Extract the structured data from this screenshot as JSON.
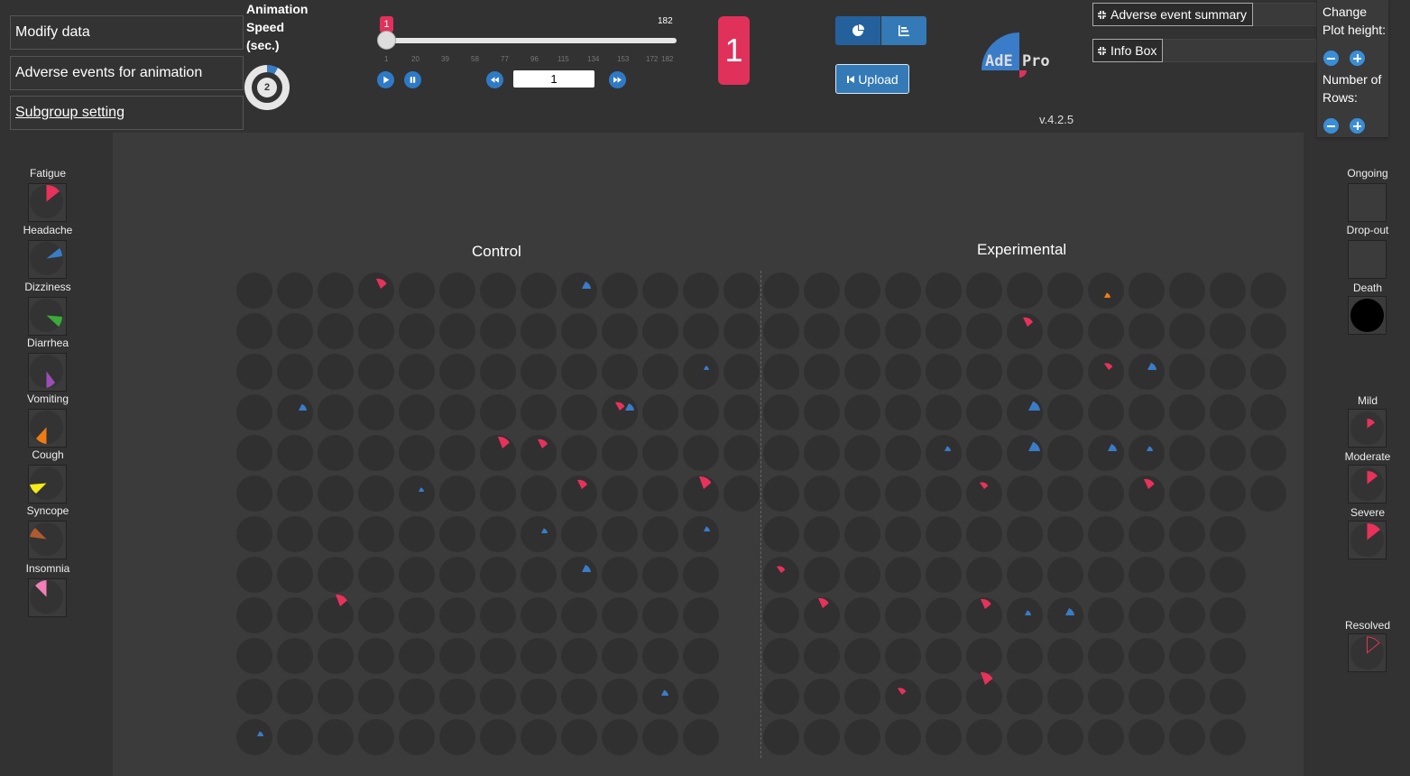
{
  "menu": {
    "modify_data": "Modify data",
    "adverse_events_animation": "Adverse events for animation",
    "subgroup_setting": "Subgroup setting"
  },
  "speed": {
    "label_line1": "Animation",
    "label_line2": "Speed",
    "label_line3": "(sec.)",
    "value": "2"
  },
  "slider": {
    "current": "1",
    "max": "182",
    "ticks": [
      "1",
      "20",
      "39",
      "58",
      "77",
      "96",
      "115",
      "134",
      "153",
      "172",
      "182"
    ]
  },
  "day_input": "1",
  "big_day": "1",
  "upload_label": "Upload",
  "logo_text": "AdE Pro",
  "version": "v.4.2.5",
  "panels": {
    "ae_summary": "Adverse event summary",
    "info_box": "Info Box"
  },
  "right_controls": {
    "plot_height_line1": "Change",
    "plot_height_line2": "Plot height:",
    "rows_line1": "Number of",
    "rows_line2": "Rows:"
  },
  "groups": {
    "control": "Control",
    "experimental": "Experimental"
  },
  "ae_legend": [
    {
      "name": "Fatigue",
      "color": "#e8315b"
    },
    {
      "name": "Headache",
      "color": "#3a7cc8"
    },
    {
      "name": "Dizziness",
      "color": "#3aaa3a"
    },
    {
      "name": "Diarrhea",
      "color": "#9b4fb4"
    },
    {
      "name": "Vomiting",
      "color": "#f07b15"
    },
    {
      "name": "Cough",
      "color": "#f5ea1a"
    },
    {
      "name": "Syncope",
      "color": "#b05a2f"
    },
    {
      "name": "Insomnia",
      "color": "#f27fb8"
    }
  ],
  "status_legend": {
    "ongoing": "Ongoing",
    "dropout": "Drop-out",
    "death": "Death",
    "mild": "Mild",
    "moderate": "Moderate",
    "severe": "Severe",
    "resolved": "Resolved"
  },
  "colors": {
    "accent_pink": "#e0315b",
    "accent_blue": "#337ab7",
    "background": "#323232"
  }
}
